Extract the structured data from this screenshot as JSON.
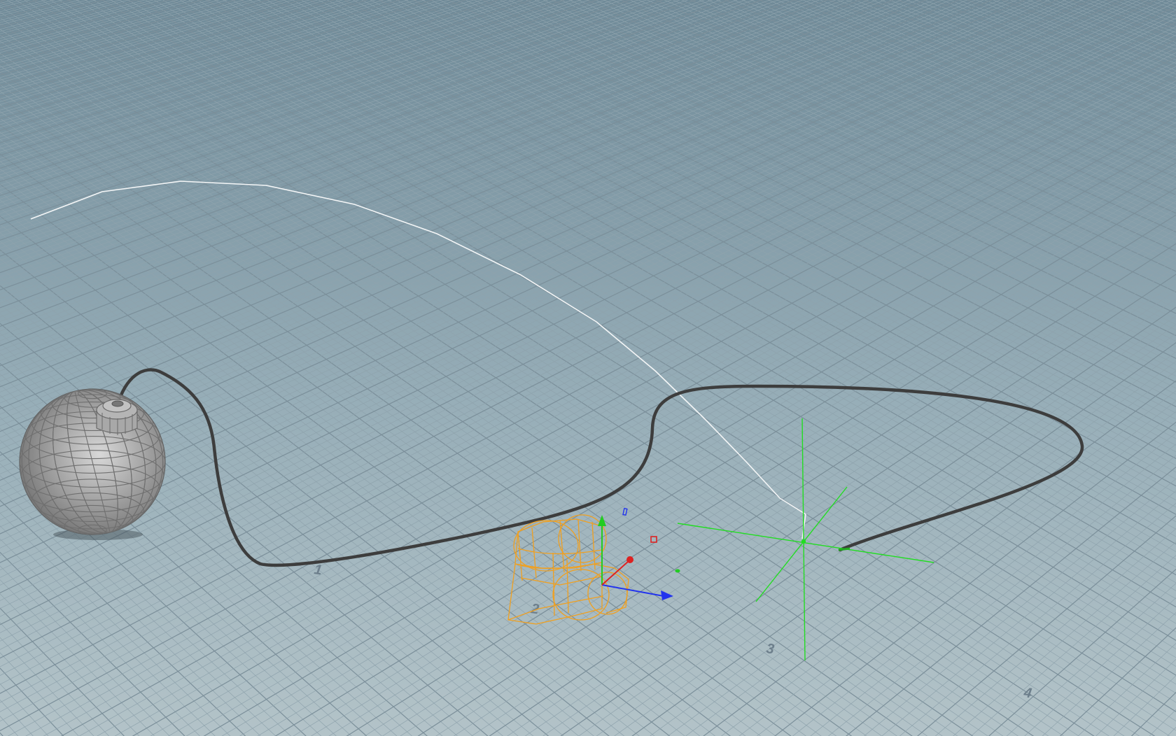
{
  "viewport": {
    "background_top": "#6f8a98",
    "background_bottom": "#b3c3c8",
    "grid_minor_color": "#8fa3ad",
    "grid_major_color": "#7b8f9a"
  },
  "grid_labels": {
    "x1": "1",
    "x2": "2",
    "x3": "3",
    "x4": "4"
  },
  "scene_objects": {
    "bomb_body_color": "#9a9a9a",
    "fuse_color": "#3a3a3a",
    "motion_path_color": "#f4f6f7",
    "selected_geometry_color": "#f0a020",
    "null_marker_color": "#22dd22",
    "gizmo_x_color": "#dd2222",
    "gizmo_y_color": "#22cc22",
    "gizmo_z_color": "#2233ee"
  }
}
